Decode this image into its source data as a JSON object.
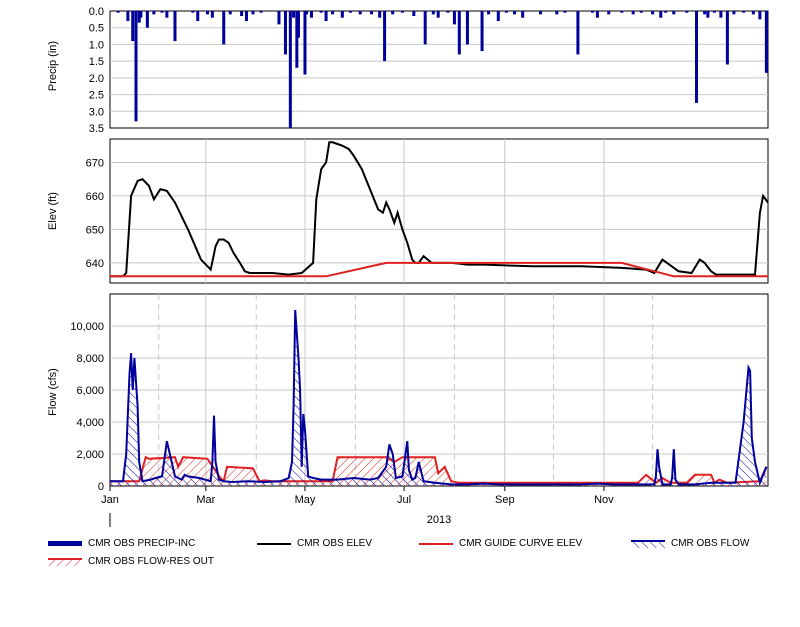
{
  "colors": {
    "precip": "#00009c",
    "elev": "#000000",
    "guide": "#e02020",
    "flow": "#00009c",
    "resout": "#e02020",
    "grid": "#c8c8c8"
  },
  "legend": {
    "precip": "CMR OBS PRECIP-INC",
    "elev": "CMR OBS ELEV",
    "guide": "CMR GUIDE CURVE ELEV",
    "flow": "CMR OBS FLOW",
    "resout": "CMR OBS FLOW-RES OUT"
  },
  "chart_data": [
    {
      "type": "bar",
      "ylabel": "Precip (in)",
      "ylim": [
        0,
        3.5
      ],
      "y_inverted": true,
      "yticks": [
        "0.0",
        "0.5",
        "1.0",
        "1.5",
        "2.0",
        "2.5",
        "3.0",
        "3.5"
      ],
      "grid": true,
      "series": [
        {
          "name": "CMR OBS PRECIP-INC",
          "x": [
            5,
            11,
            14,
            16,
            18,
            19,
            23,
            27,
            32,
            35,
            40,
            51,
            54,
            60,
            63,
            70,
            74,
            81,
            84,
            88,
            93,
            104,
            108,
            111,
            113,
            115,
            116,
            120,
            121,
            124,
            130,
            133,
            137,
            143,
            148,
            154,
            161,
            166,
            169,
            174,
            180,
            187,
            194,
            199,
            202,
            208,
            212,
            215,
            220,
            229,
            233,
            239,
            244,
            249,
            254,
            265,
            275,
            280,
            288,
            297,
            300,
            307,
            315,
            322,
            327,
            334,
            339,
            342,
            347,
            355,
            361,
            366,
            368,
            372,
            376,
            380,
            384,
            390,
            396,
            400,
            404
          ],
          "values": [
            0.05,
            0.3,
            0.9,
            3.3,
            0.35,
            0.2,
            0.5,
            0.1,
            0.05,
            0.2,
            0.9,
            0.05,
            0.3,
            0.1,
            0.2,
            1.0,
            0.1,
            0.15,
            0.3,
            0.1,
            0.05,
            0.4,
            1.3,
            3.5,
            0.2,
            1.7,
            0.8,
            1.9,
            0.1,
            0.2,
            0.05,
            0.3,
            0.1,
            0.2,
            0.05,
            0.1,
            0.1,
            0.2,
            1.5,
            0.1,
            0.05,
            0.15,
            1.0,
            0.1,
            0.2,
            0.05,
            0.4,
            1.3,
            1.0,
            1.2,
            0.1,
            0.3,
            0.05,
            0.1,
            0.2,
            0.1,
            0.1,
            0.05,
            1.3,
            0.05,
            0.2,
            0.1,
            0.05,
            0.1,
            0.05,
            0.1,
            0.2,
            0.05,
            0.1,
            0.05,
            2.75,
            0.1,
            0.2,
            0.05,
            0.2,
            1.6,
            0.1,
            0.05,
            0.1,
            0.25,
            1.85
          ]
        }
      ]
    },
    {
      "type": "line",
      "ylabel": "Elev (ft)",
      "ylim": [
        634,
        677
      ],
      "yticks": [
        "640",
        "650",
        "660",
        "670"
      ],
      "grid": true,
      "series": [
        {
          "name": "CMR OBS ELEV",
          "x": [
            0,
            8,
            10,
            13,
            17,
            20,
            24,
            27,
            31,
            35,
            40,
            48,
            56,
            62,
            65,
            67,
            70,
            73,
            76,
            80,
            83,
            86,
            90,
            95,
            100,
            110,
            118,
            125,
            127,
            130,
            133,
            135,
            137,
            140,
            143,
            147,
            150,
            155,
            160,
            165,
            168,
            170,
            172,
            175,
            177,
            180,
            183,
            186,
            188,
            190,
            193,
            198,
            202,
            206,
            210,
            215,
            220,
            230,
            260,
            290,
            315,
            330,
            335,
            340,
            350,
            358,
            363,
            366,
            370,
            373,
            380,
            390,
            397,
            400,
            402,
            405
          ],
          "values": [
            636,
            636,
            637,
            660,
            664.5,
            665,
            663,
            659,
            662,
            661.5,
            658,
            650,
            641,
            638,
            645,
            647,
            647,
            646,
            643,
            640,
            637.5,
            637,
            637,
            637,
            637,
            636.5,
            637,
            640,
            659,
            668,
            670,
            676,
            676,
            675.5,
            675,
            674,
            672,
            668,
            662,
            656,
            655,
            658,
            656,
            652,
            655,
            650,
            646,
            641,
            640,
            640,
            642,
            640,
            640,
            640,
            640,
            639.8,
            639.5,
            639.5,
            639,
            639,
            638.5,
            638,
            637,
            641,
            637.5,
            637,
            641,
            640,
            637.5,
            636.5,
            636.5,
            636.5,
            636.5,
            655,
            660,
            658
          ]
        },
        {
          "name": "CMR GUIDE CURVE ELEV",
          "x": [
            0,
            133,
            170,
            190,
            315,
            347,
            405
          ],
          "values": [
            636,
            636,
            640,
            640,
            640,
            636,
            636
          ]
        }
      ]
    },
    {
      "type": "area",
      "ylabel": "Flow (cfs)",
      "ylim": [
        0,
        12000
      ],
      "yticks": [
        "0",
        "2,000",
        "4,000",
        "6,000",
        "8,000",
        "10,000"
      ],
      "grid": true,
      "x_ticks": [
        "Jan",
        "Mar",
        "May",
        "Jul",
        "Sep",
        "Nov"
      ],
      "x_label": "2013",
      "series": [
        {
          "name": "CMR OBS FLOW",
          "x": [
            0,
            8,
            10,
            12,
            13,
            14,
            15,
            17,
            18,
            20,
            25,
            28,
            32,
            35,
            40,
            42,
            44,
            46,
            48,
            55,
            62,
            63,
            64,
            65,
            67,
            70,
            75,
            85,
            95,
            105,
            110,
            112,
            113,
            114,
            116,
            117,
            118,
            119,
            120,
            122,
            125,
            130,
            140,
            150,
            160,
            165,
            170,
            172,
            174,
            176,
            180,
            183,
            184,
            186,
            188,
            190,
            193,
            200,
            210,
            220,
            230,
            240,
            260,
            290,
            300,
            310,
            330,
            335,
            336,
            337,
            338,
            340,
            345,
            346,
            347,
            348,
            350,
            360,
            370,
            385,
            390,
            393,
            394,
            395,
            397,
            400,
            404
          ],
          "values": [
            300,
            300,
            2000,
            7000,
            8300,
            6000,
            8000,
            5000,
            1500,
            300,
            400,
            500,
            600,
            2800,
            600,
            500,
            400,
            700,
            600,
            500,
            300,
            1500,
            4400,
            1500,
            400,
            300,
            250,
            300,
            250,
            300,
            500,
            1500,
            5000,
            11000,
            8000,
            6000,
            1200,
            4500,
            3500,
            600,
            500,
            400,
            400,
            500,
            400,
            500,
            1200,
            2600,
            2000,
            500,
            600,
            2800,
            1000,
            400,
            500,
            1500,
            300,
            200,
            100,
            100,
            150,
            100,
            100,
            100,
            150,
            100,
            100,
            100,
            600,
            2300,
            1200,
            100,
            100,
            500,
            2300,
            400,
            100,
            100,
            200,
            200,
            4000,
            7400,
            7200,
            3000,
            1500,
            200,
            1200
          ]
        },
        {
          "name": "CMR OBS FLOW-RES OUT",
          "x": [
            0,
            18,
            22,
            24,
            40,
            42,
            45,
            60,
            68,
            70,
            72,
            88,
            92,
            95,
            100,
            110,
            125,
            137,
            140,
            170,
            175,
            180,
            200,
            202,
            206,
            210,
            215,
            260,
            310,
            325,
            330,
            336,
            340,
            345,
            355,
            360,
            370,
            372,
            375,
            380,
            400,
            404
          ],
          "values": [
            300,
            300,
            1800,
            1700,
            1800,
            1200,
            1800,
            1700,
            500,
            300,
            1200,
            1100,
            300,
            350,
            300,
            300,
            300,
            300,
            1800,
            1800,
            1500,
            1800,
            1800,
            800,
            1200,
            300,
            200,
            200,
            200,
            200,
            700,
            200,
            500,
            200,
            200,
            700,
            700,
            200,
            400,
            200,
            300,
            1200
          ]
        }
      ]
    }
  ]
}
